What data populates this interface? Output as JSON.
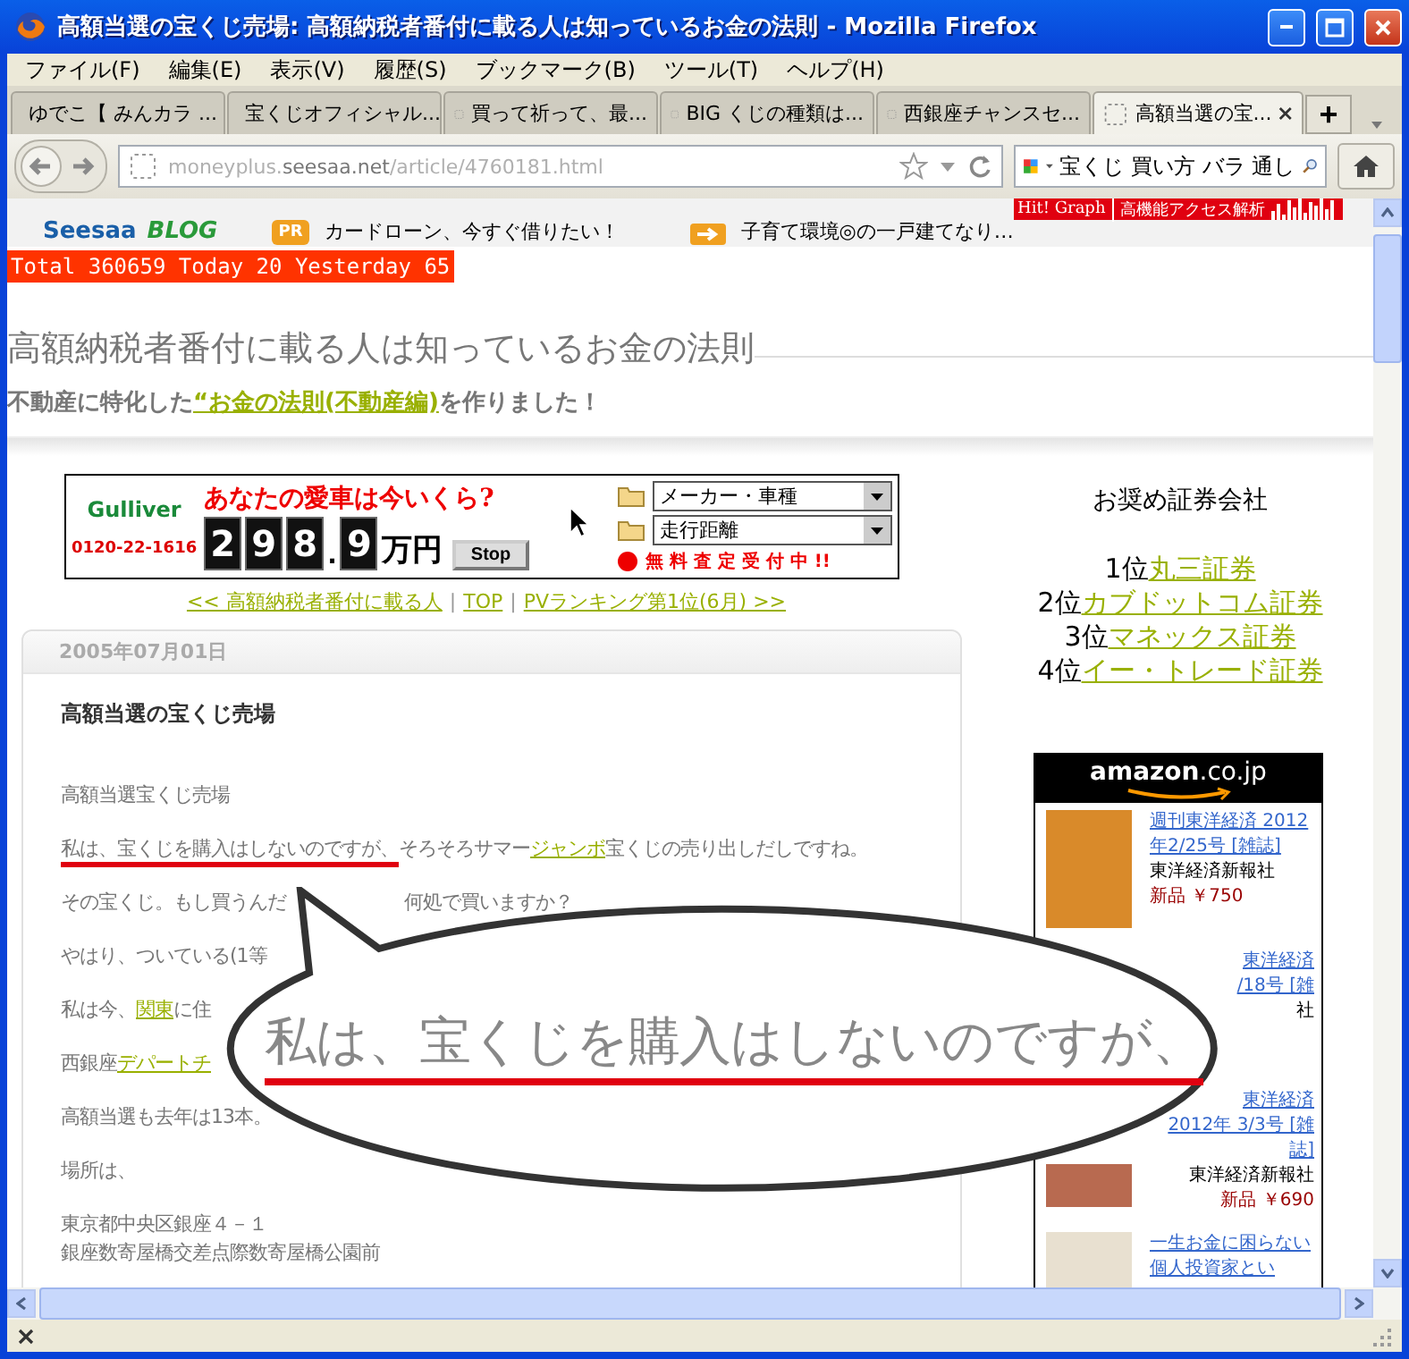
{
  "window": {
    "title": "高額当選の宝くじ売場: 高額納税者番付に載る人は知っているお金の法則 - Mozilla Firefox"
  },
  "menu": [
    "ファイル(F)",
    "編集(E)",
    "表示(V)",
    "履歴(S)",
    "ブックマーク(B)",
    "ツール(T)",
    "ヘルプ(H)"
  ],
  "tabs": [
    {
      "label": "ゆでこ【 みんカラ ...",
      "selected": false,
      "kind": "site"
    },
    {
      "label": "宝くじオフィシャル...",
      "selected": false,
      "kind": "blank"
    },
    {
      "label": "買って祈って、最...",
      "selected": false,
      "kind": "blank"
    },
    {
      "label": "BIG くじの種類は...",
      "selected": false,
      "kind": "blank"
    },
    {
      "label": "西銀座チャンスセ...",
      "selected": false,
      "kind": "blank"
    },
    {
      "label": "高額当選の宝...",
      "selected": true,
      "kind": "blank"
    }
  ],
  "new_tab": "+",
  "address": {
    "subdomain": "moneyplus.",
    "domain": "seesaa.net",
    "path": "/article/4760181.html"
  },
  "search": {
    "value": "宝くじ 買い方 バラ 通し"
  },
  "seesaa_bar": {
    "logo": "Seesaa",
    "logo_suffix": "BLOG",
    "pr_badge": "PR",
    "ad_text": "カードローン、今すぐ借りたい！",
    "promo_text": "子育て環境◎の一戸建てなり…"
  },
  "hit_graph": {
    "label": "Hit! Graph",
    "text": "高機能アクセス解析"
  },
  "counter": "Total 360659 Today 20 Yesterday 65",
  "blog": {
    "title": "高額納税者番付に載る人は知っているお金の法則",
    "subtitle_before": "不動産に特化した",
    "subtitle_link": "“お金の法則(不動産編)",
    "subtitle_after": "を作りました！"
  },
  "ad_banner": {
    "logo": "Gulliver",
    "phone": "0120-22-1616",
    "headline": "あなたの愛車は今いくら?",
    "digits": [
      "2",
      "9",
      "8"
    ],
    "decimal_point": ".",
    "decimal_digit": "9",
    "unit": "万円",
    "stop_button": "Stop",
    "selects": [
      "メーカー・車種",
      "走行距離"
    ],
    "notice": "無 料 査 定 受 付 中 !!"
  },
  "post_nav": {
    "links": [
      "<< 高額納税者番付に載る人",
      "TOP",
      "PVランキング第1位(6月) >>"
    ],
    "separator": "|"
  },
  "article": {
    "date": "2005年07月01日",
    "title": "高額当選の宝くじ売場",
    "paragraphs": [
      {
        "segments": [
          {
            "kind": "text",
            "text": "高額当選宝くじ売場"
          }
        ]
      },
      {
        "segments": [
          {
            "kind": "underlined",
            "text": "私は、宝くじを購入はしないのですが、"
          },
          {
            "kind": "text",
            "text": "そろそろサマー"
          },
          {
            "kind": "link",
            "text": "ジャンボ"
          },
          {
            "kind": "text",
            "text": "宝くじの売り出しだしですね。"
          }
        ]
      },
      {
        "segments": [
          {
            "kind": "text",
            "text": "その宝くじ。もし買うんだ"
          },
          {
            "kind": "resumed",
            "text": "何処で買いますか？"
          }
        ]
      },
      {
        "segments": [
          {
            "kind": "text",
            "text": "やはり、ついている(1等"
          }
        ]
      },
      {
        "segments": [
          {
            "kind": "text",
            "text": "私は今、"
          },
          {
            "kind": "link",
            "text": "関東"
          },
          {
            "kind": "text",
            "text": "に住"
          }
        ]
      },
      {
        "segments": [
          {
            "kind": "text",
            "text": "西銀座"
          },
          {
            "kind": "link",
            "text": "デパートチ"
          }
        ]
      },
      {
        "segments": [
          {
            "kind": "text",
            "text": "高額当選も去年は13本。"
          }
        ]
      },
      {
        "segments": [
          {
            "kind": "text",
            "text": "場所は、"
          }
        ]
      },
      {
        "segments": [
          {
            "kind": "text",
            "text": "東京都中央区銀座４－１"
          },
          {
            "kind": "line",
            "text": "銀座数寄屋橋交差点際数寄屋橋公園前"
          }
        ]
      }
    ]
  },
  "sidebar": {
    "heading": "お奨め証券会社",
    "ranks": [
      {
        "rank": "1位",
        "name": "丸三証券"
      },
      {
        "rank": "2位",
        "name": "カブドットコム証券"
      },
      {
        "rank": "3位",
        "name": "マネックス証券"
      },
      {
        "rank": "4位",
        "name": "イー・トレード証券"
      }
    ]
  },
  "amazon": {
    "logo": "amazon",
    "logo_suffix": ".co.jp",
    "items": [
      {
        "kind": "full",
        "title_lines": [
          "週刊東洋経済 2012",
          "年2/25号 [雑誌]"
        ],
        "publisher": "東洋経済新報社",
        "price": "新品 ￥750"
      },
      {
        "kind": "covered",
        "title_lines": [
          "東洋経済",
          "/18号 [雑"
        ],
        "publisher": "社"
      },
      {
        "kind": "cover_cut",
        "title_lines": [
          "東洋経済",
          "2012年 3/3号 [雑",
          "誌]"
        ],
        "publisher": "東洋経済新報社",
        "price": "新品 ￥690"
      },
      {
        "kind": "full",
        "title_lines": [
          "一生お金に困らない",
          "個人投資家とい"
        ]
      }
    ]
  },
  "callout": {
    "text": "私は、宝くじを購入はしないのですが、"
  }
}
